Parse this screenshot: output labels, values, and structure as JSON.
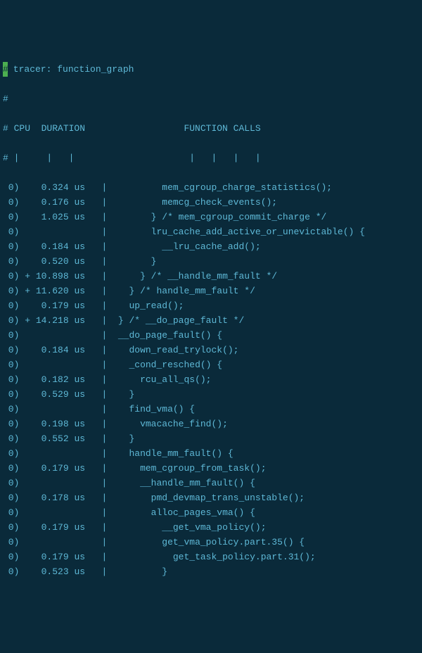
{
  "header": {
    "title_line": " tracer: function_graph",
    "hash_only": "#",
    "columns_line": "# CPU  DURATION                  FUNCTION CALLS",
    "ruler_line": "# |     |   |                     |   |   |   |"
  },
  "rows": [
    {
      "cpu": " 0)",
      "flag": " ",
      "dur": "  0.324 us",
      "sep": "   |  ",
      "call": "        mem_cgroup_charge_statistics();"
    },
    {
      "cpu": " 0)",
      "flag": " ",
      "dur": "  0.176 us",
      "sep": "   |  ",
      "call": "        memcg_check_events();"
    },
    {
      "cpu": " 0)",
      "flag": " ",
      "dur": "  1.025 us",
      "sep": "   |  ",
      "call": "      } /* mem_cgroup_commit_charge */"
    },
    {
      "cpu": " 0)",
      "flag": " ",
      "dur": "          ",
      "sep": "   |  ",
      "call": "      lru_cache_add_active_or_unevictable() {"
    },
    {
      "cpu": " 0)",
      "flag": " ",
      "dur": "  0.184 us",
      "sep": "   |  ",
      "call": "        __lru_cache_add();"
    },
    {
      "cpu": " 0)",
      "flag": " ",
      "dur": "  0.520 us",
      "sep": "   |  ",
      "call": "      }"
    },
    {
      "cpu": " 0)",
      "flag": "+",
      "dur": " 10.898 us",
      "sep": "   |  ",
      "call": "    } /* __handle_mm_fault */"
    },
    {
      "cpu": " 0)",
      "flag": "+",
      "dur": " 11.620 us",
      "sep": "   |  ",
      "call": "  } /* handle_mm_fault */"
    },
    {
      "cpu": " 0)",
      "flag": " ",
      "dur": "  0.179 us",
      "sep": "   |  ",
      "call": "  up_read();"
    },
    {
      "cpu": " 0)",
      "flag": "+",
      "dur": " 14.218 us",
      "sep": "   |  ",
      "call": "} /* __do_page_fault */"
    },
    {
      "cpu": " 0)",
      "flag": " ",
      "dur": "          ",
      "sep": "   |  ",
      "call": "__do_page_fault() {"
    },
    {
      "cpu": " 0)",
      "flag": " ",
      "dur": "  0.184 us",
      "sep": "   |  ",
      "call": "  down_read_trylock();"
    },
    {
      "cpu": " 0)",
      "flag": " ",
      "dur": "          ",
      "sep": "   |  ",
      "call": "  _cond_resched() {"
    },
    {
      "cpu": " 0)",
      "flag": " ",
      "dur": "  0.182 us",
      "sep": "   |  ",
      "call": "    rcu_all_qs();"
    },
    {
      "cpu": " 0)",
      "flag": " ",
      "dur": "  0.529 us",
      "sep": "   |  ",
      "call": "  }"
    },
    {
      "cpu": " 0)",
      "flag": " ",
      "dur": "          ",
      "sep": "   |  ",
      "call": "  find_vma() {"
    },
    {
      "cpu": " 0)",
      "flag": " ",
      "dur": "  0.198 us",
      "sep": "   |  ",
      "call": "    vmacache_find();"
    },
    {
      "cpu": " 0)",
      "flag": " ",
      "dur": "  0.552 us",
      "sep": "   |  ",
      "call": "  }"
    },
    {
      "cpu": " 0)",
      "flag": " ",
      "dur": "          ",
      "sep": "   |  ",
      "call": "  handle_mm_fault() {"
    },
    {
      "cpu": " 0)",
      "flag": " ",
      "dur": "  0.179 us",
      "sep": "   |  ",
      "call": "    mem_cgroup_from_task();"
    },
    {
      "cpu": " 0)",
      "flag": " ",
      "dur": "          ",
      "sep": "   |  ",
      "call": "    __handle_mm_fault() {"
    },
    {
      "cpu": " 0)",
      "flag": " ",
      "dur": "  0.178 us",
      "sep": "   |  ",
      "call": "      pmd_devmap_trans_unstable();"
    },
    {
      "cpu": " 0)",
      "flag": " ",
      "dur": "          ",
      "sep": "   |  ",
      "call": "      alloc_pages_vma() {"
    },
    {
      "cpu": " 0)",
      "flag": " ",
      "dur": "  0.179 us",
      "sep": "   |  ",
      "call": "        __get_vma_policy();"
    },
    {
      "cpu": " 0)",
      "flag": " ",
      "dur": "          ",
      "sep": "   |  ",
      "call": "        get_vma_policy.part.35() {"
    },
    {
      "cpu": " 0)",
      "flag": " ",
      "dur": "  0.179 us",
      "sep": "   |  ",
      "call": "          get_task_policy.part.31();"
    },
    {
      "cpu": " 0)",
      "flag": " ",
      "dur": "  0.523 us",
      "sep": "   |  ",
      "call": "        }"
    }
  ]
}
